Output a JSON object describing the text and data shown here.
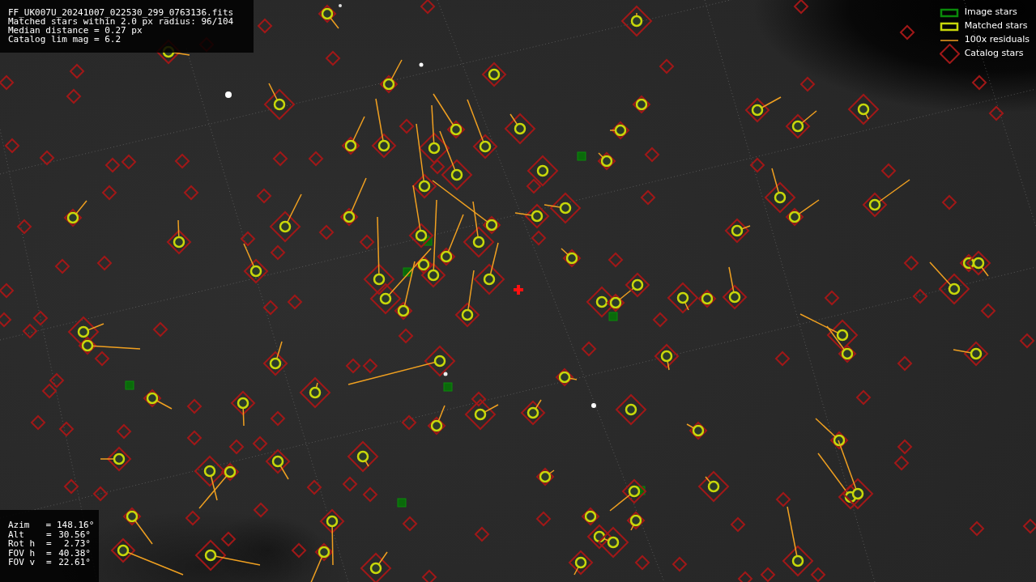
{
  "info_lines": [
    "FF_UK007U_20241007_022530_299_0763136.fits",
    "Matched stars within 2.0 px radius: 96/104",
    "Median distance = 0.27 px",
    "Catalog lim mag = 6.2"
  ],
  "legend": [
    {
      "label": "Image stars"
    },
    {
      "kind": "matched",
      "label": "Matched stars"
    },
    {
      "kind": "residual",
      "label": "100x residuals"
    },
    {
      "kind": "catalog",
      "label": "Catalog stars"
    }
  ],
  "camera": [
    {
      "label": "Azim",
      "equals": "=",
      "value": "148.16°"
    },
    {
      "label": "Alt",
      "equals": "=",
      "value": "30.56°"
    },
    {
      "label": "Rot h",
      "equals": "=",
      "value": "2.73°"
    },
    {
      "label": "FOV h",
      "equals": "=",
      "value": "40.38°"
    },
    {
      "label": "FOV v",
      "equals": "=",
      "value": "22.61°"
    }
  ]
}
